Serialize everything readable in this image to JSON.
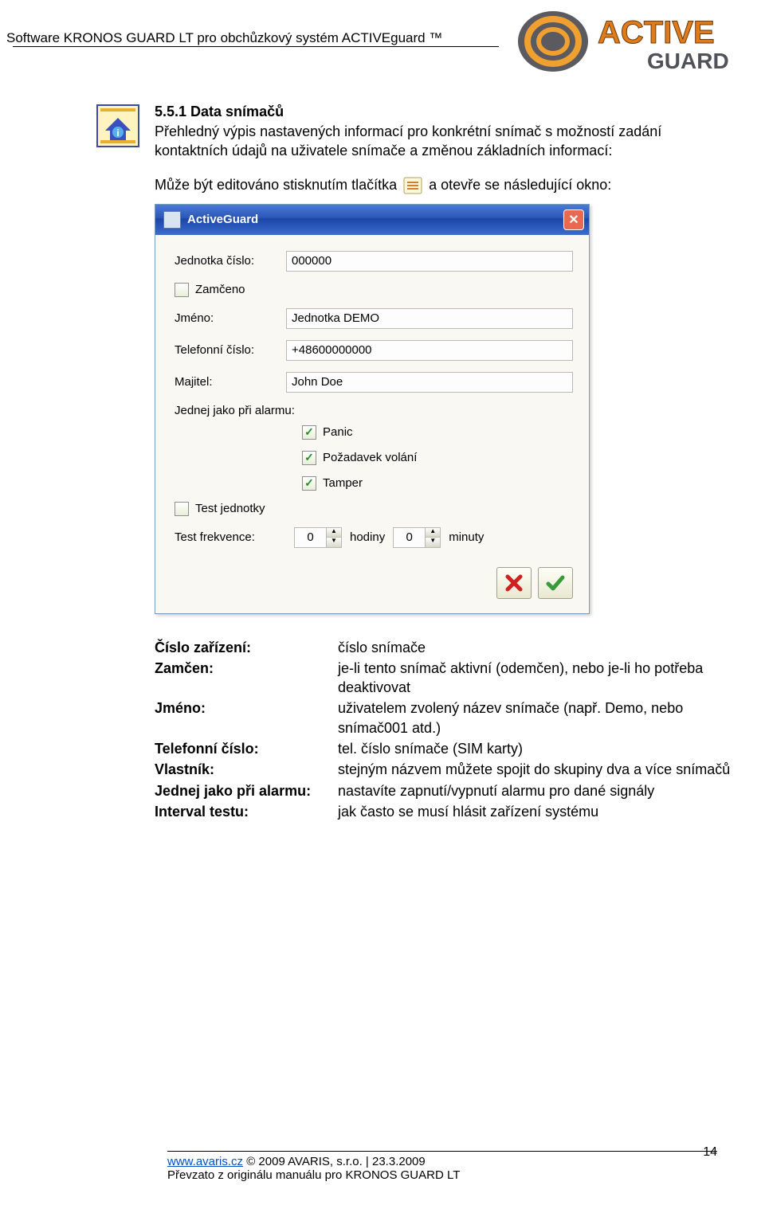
{
  "header": {
    "title": "Software KRONOS GUARD LT pro obchůzkový systém ACTIVEguard ™",
    "logo_top": "ACTIVE",
    "logo_bottom": "GUARD"
  },
  "section": {
    "number_title": "5.5.1 Data snímačů",
    "desc": "Přehledný výpis nastavených informací pro konkrétní snímač s možností zadání kontaktních údajů na uživatele snímače a změnou základních informací:",
    "edit_prefix": "Může být editováno stisknutím tlačítka",
    "edit_suffix": "a otevře se následující okno:"
  },
  "dialog": {
    "title": "ActiveGuard",
    "fields": {
      "unit_no_label": "Jednotka číslo:",
      "unit_no_value": "000000",
      "locked_label": "Zamčeno",
      "name_label": "Jméno:",
      "name_value": "Jednotka DEMO",
      "phone_label": "Telefonní číslo:",
      "phone_value": "+48600000000",
      "owner_label": "Majitel:",
      "owner_value": "John Doe",
      "alarm_label": "Jednej jako při alarmu:",
      "alarm_panic": "Panic",
      "alarm_call": "Požadavek volání",
      "alarm_tamper": "Tamper",
      "test_unit": "Test jednotky",
      "test_freq_label": "Test frekvence:",
      "hours_value": "0",
      "hours_label": "hodiny",
      "minutes_value": "0",
      "minutes_label": "minuty"
    },
    "actions": {
      "cancel": "✖",
      "ok": "✔"
    }
  },
  "defs": {
    "device_no_term": "Číslo zařízení:",
    "device_no_val": "číslo snímače",
    "locked_term": "Zamčen:",
    "locked_val": "je-li tento snímač aktivní (odemčen), nebo je-li ho potřeba deaktivovat",
    "name_term": "Jméno:",
    "name_val": "uživatelem zvolený název snímače (např. Demo, nebo snímač001 atd.)",
    "phone_term": "Telefonní číslo:",
    "phone_val": "tel. číslo snímače (SIM karty)",
    "owner_term": "Vlastník:",
    "owner_val": "stejným názvem můžete spojit do skupiny dva a více snímačů",
    "alarm_term": "Jednej jako při alarmu:",
    "alarm_val": "nastavíte zapnutí/vypnutí alarmu pro dané signály",
    "interval_term": "Interval testu:",
    "interval_val": "jak často se musí hlásit zařízení systému"
  },
  "footer": {
    "link": "www.avaris.cz",
    "rest": " © 2009 AVARIS, s.r.o. | 23.3.2009",
    "line2": "Převzato z originálu manuálu pro KRONOS GUARD LT",
    "page": "14"
  }
}
